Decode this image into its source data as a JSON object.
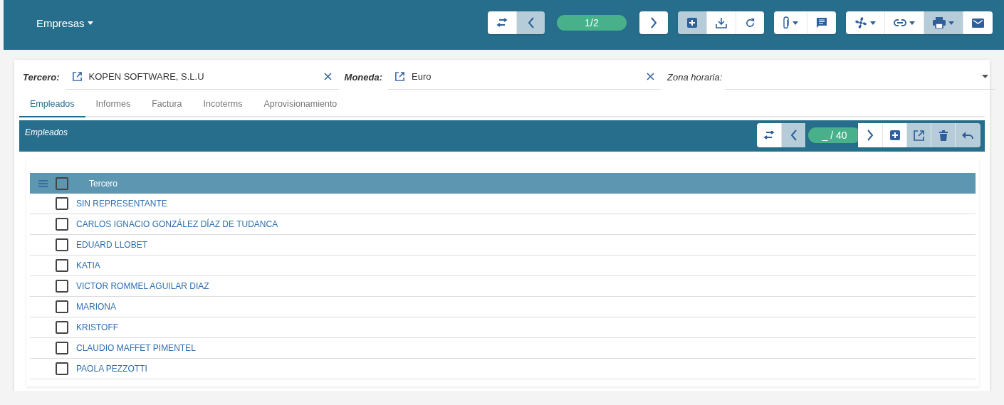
{
  "header": {
    "title": "Empresas",
    "toolbar": [
      {
        "kind": "button",
        "highlighted": false,
        "dropdown": false
      },
      {
        "kind": "button",
        "highlighted": true,
        "dropdown": false
      },
      {
        "kind": "counter",
        "text": "1/2"
      },
      {
        "kind": "button",
        "highlighted": false,
        "dropdown": false
      },
      {
        "kind": "gap"
      },
      {
        "kind": "button",
        "highlighted": true,
        "dropdown": false
      },
      {
        "kind": "button",
        "highlighted": false,
        "dropdown": false
      },
      {
        "kind": "button",
        "highlighted": false,
        "dropdown": false
      },
      {
        "kind": "gap"
      },
      {
        "kind": "button",
        "highlighted": false,
        "dropdown": true
      },
      {
        "kind": "button",
        "highlighted": false,
        "dropdown": false
      },
      {
        "kind": "gap"
      },
      {
        "kind": "button",
        "highlighted": false,
        "dropdown": true
      },
      {
        "kind": "button",
        "highlighted": false,
        "dropdown": true
      },
      {
        "kind": "button",
        "highlighted": true,
        "dropdown": true
      },
      {
        "kind": "button",
        "highlighted": false,
        "dropdown": false
      }
    ]
  },
  "fields": [
    {
      "label": "Tercero:",
      "value": "KOPEN SOFTWARE, S.L.U",
      "kind": "link"
    },
    {
      "label": "Moneda:",
      "value": "Euro",
      "kind": "link"
    },
    {
      "label": "Zona horaria:",
      "kind": "select"
    }
  ],
  "tabs": [
    {
      "label": "Empleados",
      "selected": true
    },
    {
      "label": "Informes",
      "selected": false
    },
    {
      "label": "Factura",
      "selected": false
    },
    {
      "label": "Incoterms",
      "selected": false
    },
    {
      "label": "Aprovisionamiento",
      "selected": false
    }
  ],
  "panel": {
    "title": "Empleados",
    "toolbar": [
      {
        "kind": "button",
        "highlighted": false,
        "dropdown": false
      },
      {
        "kind": "button",
        "highlighted": true,
        "dropdown": false
      },
      {
        "kind": "counter",
        "text": "_ / 40"
      },
      {
        "kind": "button",
        "highlighted": false,
        "dropdown": false
      },
      {
        "kind": "button",
        "highlighted": false,
        "dropdown": false
      },
      {
        "kind": "button",
        "highlighted": true,
        "dropdown": false
      },
      {
        "kind": "button",
        "highlighted": true,
        "dropdown": false
      },
      {
        "kind": "button",
        "highlighted": true,
        "dropdown": false
      }
    ],
    "table": {
      "columns": [
        "Tercero"
      ],
      "header_checked": false,
      "rows": [
        {
          "name": "SIN REPRESENTANTE",
          "checked": false
        },
        {
          "name": "CARLOS IGNACIO GONZÁLEZ DÍAZ DE TUDANCA",
          "checked": false
        },
        {
          "name": "EDUARD LLOBET",
          "checked": false
        },
        {
          "name": "KATIA",
          "checked": false
        },
        {
          "name": "VICTOR ROMMEL AGUILAR DIAZ",
          "checked": false
        },
        {
          "name": "MARIONA",
          "checked": false
        },
        {
          "name": "KRISTOFF",
          "checked": false
        },
        {
          "name": "CLAUDIO MAFFET PIMENTEL",
          "checked": false
        },
        {
          "name": "PAOLA PEZZOTTI",
          "checked": false
        }
      ]
    }
  }
}
